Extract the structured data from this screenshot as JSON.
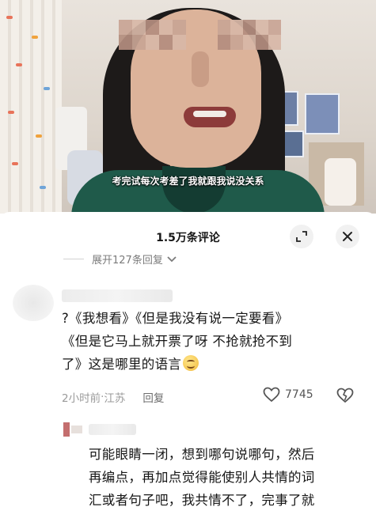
{
  "video": {
    "subtitle": "考完试每次考差了我就跟我说没关系"
  },
  "comments_panel": {
    "title": "1.5万条评论",
    "expand_label": "展开127条回复",
    "expand_icon": "chevron-down-icon",
    "fullscreen_icon": "expand-icon",
    "close_icon": "close-icon"
  },
  "comment1": {
    "lines": [
      "?《我想看》《但是我没有说一定要看》",
      "《但是它马上就开票了呀 不抢就抢不到",
      "了》这是哪里的语言"
    ],
    "emoji": "smile-emoji",
    "time": "2小时前",
    "separator": " · ",
    "location": "江苏",
    "reply_label": "回复",
    "like_count": "7745",
    "like_icon": "heart-icon",
    "dislike_icon": "broken-heart-icon"
  },
  "comment2": {
    "lines": [
      "可能眼睛一闭，想到哪句说哪句，然后",
      "再编点，再加点觉得能使别人共情的词",
      "汇或者句子吧，我共情不了，完事了就"
    ]
  }
}
